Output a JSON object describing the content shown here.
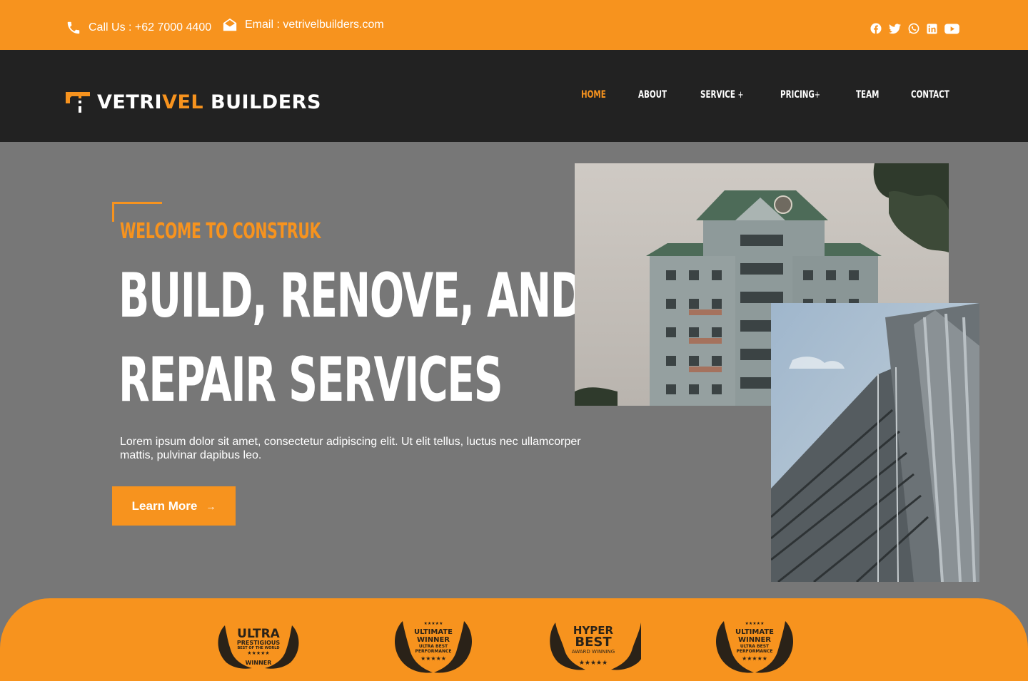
{
  "topbar": {
    "phone_label": "Call Us : +62 7000 4400",
    "email_label": "Email : vetrivelbuilders.com",
    "socials": [
      "facebook-icon",
      "twitter-icon",
      "whatsapp-icon",
      "linkedin-icon",
      "youtube-icon"
    ]
  },
  "brand": {
    "name_part1": "VETRI",
    "name_part2": "VEL",
    "name_part3": " BUILDERS"
  },
  "nav": {
    "items": [
      {
        "label": "HOME",
        "active": true
      },
      {
        "label": "ABOUT"
      },
      {
        "label": "SERVICE",
        "suffix": "+"
      },
      {
        "label": "PRICING",
        "suffix": "+"
      },
      {
        "label": "TEAM"
      },
      {
        "label": "CONTACT"
      }
    ]
  },
  "hero": {
    "eyebrow": "WELCOME TO CONSTRUK",
    "headline_line1": "BUILD, RENOVE, AND",
    "headline_line2": "REPAIR SERVICES",
    "description": "Lorem ipsum dolor sit amet, consectetur adipiscing elit. Ut elit tellus, luctus nec ullamcorper mattis, pulvinar dapibus leo.",
    "cta_label": "Learn More",
    "cta_arrow": "→"
  },
  "awards": [
    {
      "line1": "ULTRA",
      "line2": "PRESTIGIOUS",
      "line3": "BEST OF THE WORLD",
      "stars": "★★★★★",
      "line4": "WINNER"
    },
    {
      "stars_top": "★★★★★",
      "line1": "ULTIMATE",
      "line2": "WINNER",
      "line3": "ULTRA BEST",
      "line4": "PERFORMANCE",
      "stars": "★★★★★"
    },
    {
      "line1": "HYPER",
      "line2": "BEST",
      "line3": "AWARD WINNING",
      "stars": "★★★★★"
    },
    {
      "stars_top": "★★★★★",
      "line1": "ULTIMATE",
      "line2": "WINNER",
      "line3": "ULTRA BEST",
      "line4": "PERFORMANCE",
      "stars": "★★★★★"
    }
  ],
  "colors": {
    "accent": "#F7931E",
    "header_bg": "#222222",
    "hero_bg": "#777777"
  }
}
